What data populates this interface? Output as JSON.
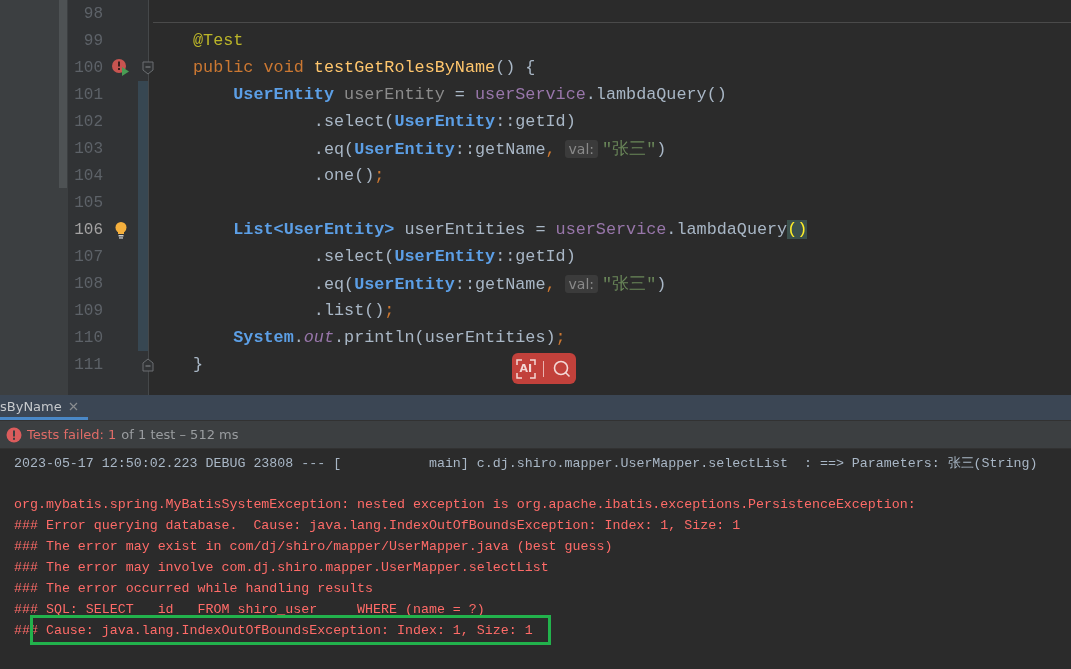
{
  "editor": {
    "lines": [
      {
        "number": "98",
        "current": false,
        "modified": false,
        "separator": true
      },
      {
        "number": "99",
        "current": false,
        "modified": false,
        "separator": false,
        "tokens": [
          {
            "kind": "annotation",
            "text": "@Test"
          }
        ]
      },
      {
        "number": "100",
        "current": false,
        "modified": false,
        "separator": false,
        "marker": {
          "kind": "test-failed"
        },
        "fold": {
          "kind": "start"
        },
        "tokens": [
          {
            "kind": "keyword",
            "text": "public void "
          },
          {
            "kind": "declaration",
            "text": "testGetRolesByName"
          },
          {
            "kind": "plain",
            "text": "() {"
          }
        ]
      },
      {
        "number": "101",
        "current": false,
        "modified": true,
        "separator": false,
        "tokens": [
          {
            "kind": "type",
            "text": "    UserEntity"
          },
          {
            "kind": "unused",
            "text": " userEntity"
          },
          {
            "kind": "plain",
            "text": " = "
          },
          {
            "kind": "field",
            "text": "userService"
          },
          {
            "kind": "plain",
            "text": ".lambdaQuery()"
          }
        ]
      },
      {
        "number": "102",
        "current": false,
        "modified": true,
        "separator": false,
        "tokens": [
          {
            "kind": "plain",
            "text": "            .select("
          },
          {
            "kind": "type",
            "text": "UserEntity"
          },
          {
            "kind": "plain",
            "text": "::getId)"
          }
        ]
      },
      {
        "number": "103",
        "current": false,
        "modified": true,
        "separator": false,
        "tokens": [
          {
            "kind": "plain",
            "text": "            .eq("
          },
          {
            "kind": "type",
            "text": "UserEntity"
          },
          {
            "kind": "plain",
            "text": "::getName"
          },
          {
            "kind": "keyword",
            "text": ","
          },
          {
            "kind": "hint",
            "text": "val:"
          },
          {
            "kind": "string",
            "text": "\"张三\""
          },
          {
            "kind": "plain",
            "text": ")"
          }
        ]
      },
      {
        "number": "104",
        "current": false,
        "modified": true,
        "separator": false,
        "tokens": [
          {
            "kind": "plain",
            "text": "            .one()"
          },
          {
            "kind": "keyword",
            "text": ";"
          }
        ]
      },
      {
        "number": "105",
        "current": false,
        "modified": true,
        "separator": false
      },
      {
        "number": "106",
        "current": true,
        "modified": true,
        "separator": false,
        "marker": {
          "kind": "bulb"
        },
        "tokens": [
          {
            "kind": "type",
            "text": "    List<UserEntity>"
          },
          {
            "kind": "plain",
            "text": " userEntities = "
          },
          {
            "kind": "field",
            "text": "userService"
          },
          {
            "kind": "plain",
            "text": ".lambdaQuery"
          },
          {
            "kind": "match",
            "text": "()"
          }
        ]
      },
      {
        "number": "107",
        "current": false,
        "modified": true,
        "separator": false,
        "tokens": [
          {
            "kind": "plain",
            "text": "            .select("
          },
          {
            "kind": "type",
            "text": "UserEntity"
          },
          {
            "kind": "plain",
            "text": "::getId)"
          }
        ]
      },
      {
        "number": "108",
        "current": false,
        "modified": true,
        "separator": false,
        "tokens": [
          {
            "kind": "plain",
            "text": "            .eq("
          },
          {
            "kind": "type",
            "text": "UserEntity"
          },
          {
            "kind": "plain",
            "text": "::getName"
          },
          {
            "kind": "keyword",
            "text": ","
          },
          {
            "kind": "hint",
            "text": "val:"
          },
          {
            "kind": "string",
            "text": "\"张三\""
          },
          {
            "kind": "plain",
            "text": ")"
          }
        ]
      },
      {
        "number": "109",
        "current": false,
        "modified": true,
        "separator": false,
        "tokens": [
          {
            "kind": "plain",
            "text": "            .list()"
          },
          {
            "kind": "keyword",
            "text": ";"
          }
        ]
      },
      {
        "number": "110",
        "current": false,
        "modified": true,
        "separator": false,
        "tokens": [
          {
            "kind": "type",
            "text": "    System"
          },
          {
            "kind": "plain",
            "text": "."
          },
          {
            "kind": "static",
            "text": "out"
          },
          {
            "kind": "plain",
            "text": ".println(userEntities)"
          },
          {
            "kind": "keyword",
            "text": ";"
          }
        ]
      },
      {
        "number": "111",
        "current": false,
        "modified": false,
        "separator": false,
        "fold": {
          "kind": "end"
        },
        "tokens": [
          {
            "kind": "plain",
            "text": "}"
          }
        ]
      }
    ],
    "floating_toolbar": {
      "ai_label": "AI"
    }
  },
  "run_panel": {
    "tabs": [
      {
        "label": "sByName",
        "selected": true
      }
    ],
    "status": {
      "result": "Tests failed: 1",
      "detail": "of 1 test – 512 ms"
    },
    "console": [
      {
        "kind": "info",
        "highlighted": false,
        "text": "2023-05-17 12:50:02.223 DEBUG 23808 --- [           main] c.dj.shiro.mapper.UserMapper.selectList  : ==> Parameters: 张三(String)"
      },
      {
        "kind": "blank"
      },
      {
        "kind": "error",
        "highlighted": false,
        "text": "org.mybatis.spring.MyBatisSystemException: nested exception is org.apache.ibatis.exceptions.PersistenceException:"
      },
      {
        "kind": "error",
        "highlighted": false,
        "text": "### Error querying database.  Cause: java.lang.IndexOutOfBoundsException: Index: 1, Size: 1"
      },
      {
        "kind": "error",
        "highlighted": false,
        "text": "### The error may exist in com/dj/shiro/mapper/UserMapper.java (best guess)"
      },
      {
        "kind": "error",
        "highlighted": false,
        "text": "### The error may involve com.dj.shiro.mapper.UserMapper.selectList"
      },
      {
        "kind": "error",
        "highlighted": false,
        "text": "### The error occurred while handling results"
      },
      {
        "kind": "error",
        "highlighted": false,
        "text": "### SQL: SELECT   id   FROM shiro_user     WHERE (name = ?)"
      },
      {
        "kind": "error",
        "highlighted": true,
        "text": "### Cause: java.lang.IndexOutOfBoundsException: Index: 1, Size: 1"
      }
    ]
  }
}
